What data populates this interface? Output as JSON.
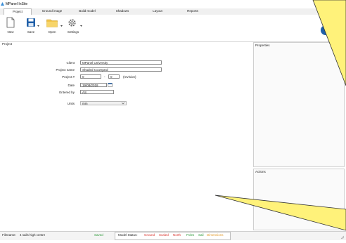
{
  "window": {
    "title": "MPanel InSite",
    "minimize": "—",
    "maximize": "□",
    "close": "✕"
  },
  "tabs": [
    {
      "label": "Project",
      "active": true
    },
    {
      "label": "Ground image",
      "active": false
    },
    {
      "label": "Build model",
      "active": false
    },
    {
      "label": "Shadows",
      "active": false
    },
    {
      "label": "Layout",
      "active": false
    },
    {
      "label": "Reports",
      "active": false
    }
  ],
  "ribbon": {
    "new_label": "New",
    "save_label": "Save",
    "open_label": "Open",
    "settings_label": "Settings"
  },
  "project_panel": {
    "title": "Project",
    "client_label": "Client",
    "client_value": "MPanel University",
    "project_name_label": "Project name",
    "project_name_value": "Shaded Courtyard",
    "project_num_label": "Project #",
    "project_num_value": "0",
    "project_num_sep": "-",
    "revision_value": "0",
    "revision_label": "(revision)",
    "date_label": "Date",
    "date_value": "19/08/2018",
    "entered_by_label": "Entered by",
    "entered_by_value": "AS",
    "units_label": "Units",
    "units_value": "mm"
  },
  "properties_panel": {
    "title": "Properties"
  },
  "actions_panel": {
    "title": "Actions"
  },
  "status": {
    "filename_label": "Filename:",
    "filename_value": "4 sails high centre",
    "saved": "Saved",
    "model_status_label": "Model Status:",
    "ground": "Ground",
    "scaled": "Scaled",
    "north": "North",
    "poles": "Poles",
    "sail": "Sail",
    "dimensions": "Dimensions"
  },
  "colors": {
    "accent": "#1f5fa8",
    "red": "#d9302a",
    "green": "#2e9a3a",
    "orange": "#e39a2a",
    "callout": "#fff27a"
  }
}
